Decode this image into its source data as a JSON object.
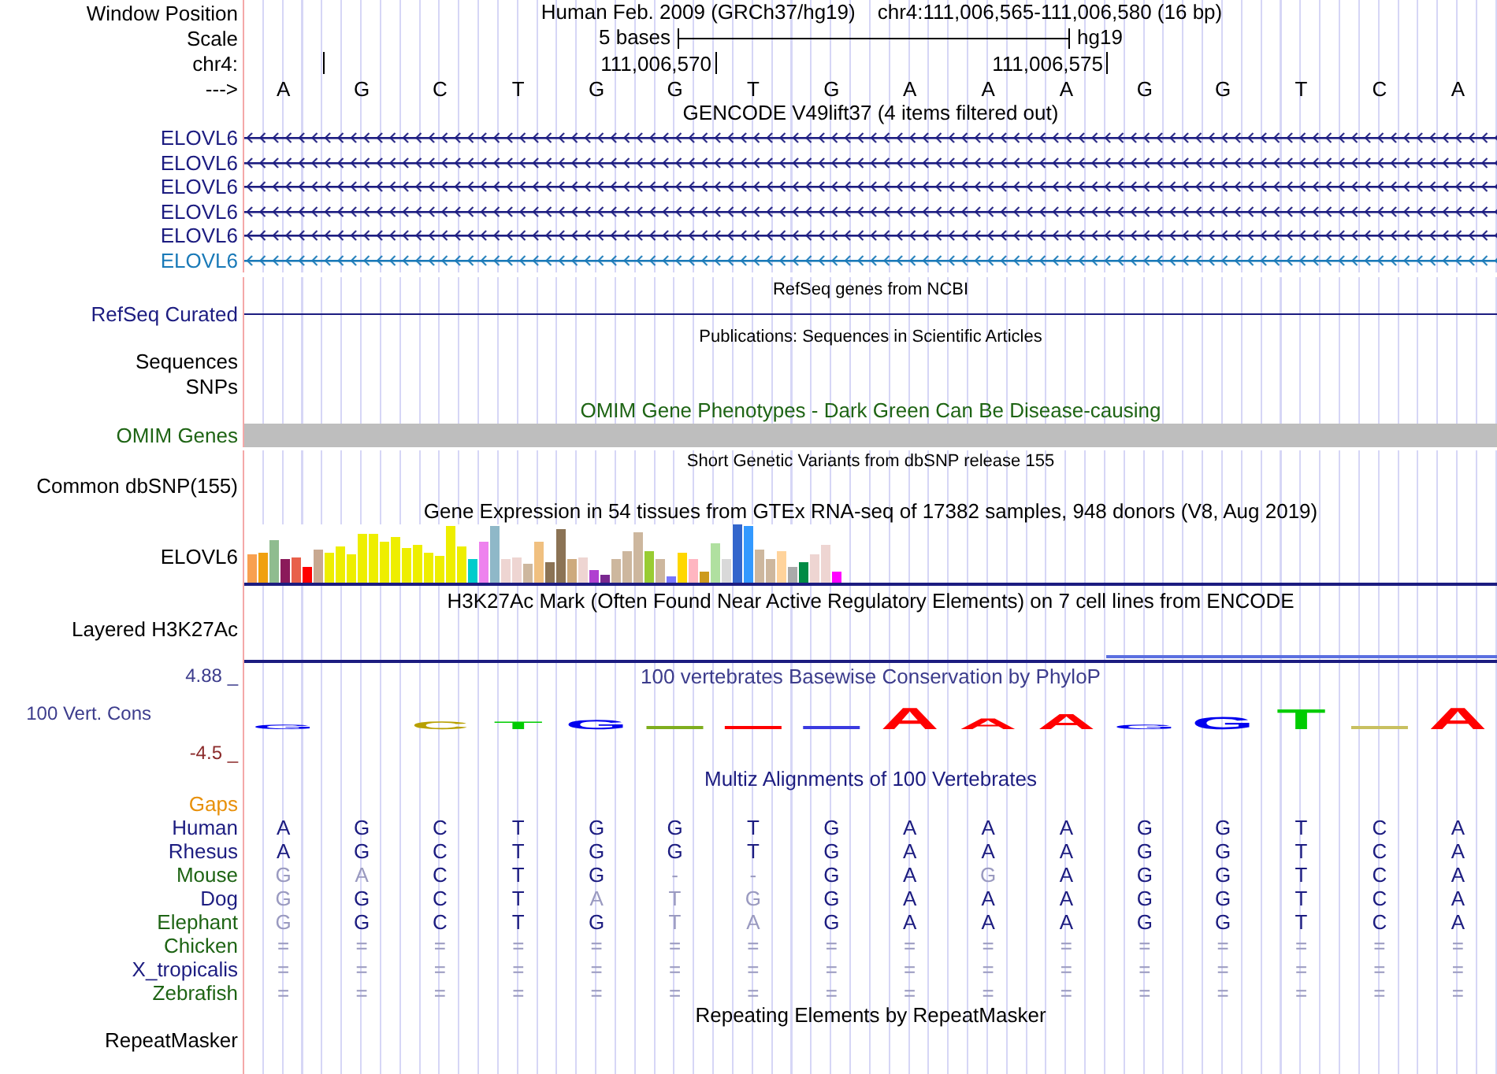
{
  "position_bar": {
    "label": "Window Position",
    "assembly": "Human Feb. 2009 (GRCh37/hg19)",
    "range": "chr4:111,006,565-111,006,580 (16 bp)"
  },
  "scale": {
    "label": "Scale",
    "span": "5 bases",
    "assembly": "hg19"
  },
  "ruler": {
    "label": "chr4:",
    "ticks": [
      "111,006,570",
      "111,006,575"
    ]
  },
  "sequence": {
    "label": "--->",
    "bases": [
      "A",
      "G",
      "C",
      "T",
      "G",
      "G",
      "T",
      "G",
      "A",
      "A",
      "A",
      "G",
      "G",
      "T",
      "C",
      "A"
    ]
  },
  "tracks": [
    {
      "kind": "genes",
      "title": "GENCODE V49lift37 (4 items filtered out)",
      "items": [
        {
          "label": "ELOVL6",
          "color": "#1c1c80"
        },
        {
          "label": "ELOVL6",
          "color": "#1c1c80"
        },
        {
          "label": "ELOVL6",
          "color": "#1c1c80"
        },
        {
          "label": "ELOVL6",
          "color": "#1c1c80"
        },
        {
          "label": "ELOVL6",
          "color": "#1c1c80"
        },
        {
          "label": "ELOVL6",
          "color": "#1a7ab8"
        }
      ]
    },
    {
      "kind": "line",
      "title": "RefSeq genes from NCBI",
      "label": "RefSeq Curated",
      "color": "#1c1c80"
    },
    {
      "kind": "labels",
      "title": "Publications: Sequences in Scientific Articles",
      "labels": [
        "Sequences",
        "SNPs"
      ]
    },
    {
      "kind": "bar",
      "title": "OMIM Gene Phenotypes - Dark Green Can Be Disease-causing",
      "label": "OMIM Genes",
      "color": "#1e6414"
    },
    {
      "kind": "labels",
      "title": "Short Genetic Variants from dbSNP release 155",
      "labels": [
        "Common dbSNP(155)"
      ]
    },
    {
      "kind": "expression",
      "title": "Gene Expression in 54 tissues from GTEx RNA-seq of 17382 samples, 948 donors (V8, Aug 2019)",
      "label": "ELOVL6"
    },
    {
      "kind": "signal",
      "title": "H3K27Ac Mark (Often Found Near Active Regulatory Elements) on 7 cell lines from ENCODE",
      "label": "Layered H3K27Ac"
    },
    {
      "kind": "conservation",
      "title": "100 vertebrates Basewise Conservation by PhyloP",
      "label": "100 Vert. Cons",
      "max": "4.88 _",
      "min": "-4.5 _",
      "logo": [
        {
          "kind": "letter",
          "letter": "G"
        },
        {
          "kind": "blank"
        },
        {
          "kind": "letter",
          "letter": "C"
        },
        {
          "kind": "letter",
          "letter": "T"
        },
        {
          "kind": "letter",
          "letter": "G"
        },
        {
          "kind": "flat",
          "color": "#7fae1e"
        },
        {
          "kind": "flat",
          "color": "#ff0000"
        },
        {
          "kind": "flat",
          "color": "#3a3ae0"
        },
        {
          "kind": "letter",
          "letter": "A"
        },
        {
          "kind": "letter",
          "letter": "A"
        },
        {
          "kind": "letter",
          "letter": "A"
        },
        {
          "kind": "letter",
          "letter": "G"
        },
        {
          "kind": "letter",
          "letter": "G"
        },
        {
          "kind": "letter",
          "letter": "T"
        },
        {
          "kind": "flat",
          "color": "#c8c060"
        },
        {
          "kind": "letter",
          "letter": "A"
        }
      ]
    },
    {
      "kind": "alignment",
      "title": "Multiz Alignments of 100 Vertebrates",
      "gaps_label": "Gaps",
      "species": [
        {
          "name": "Human",
          "color": "#1c1c80",
          "bases": [
            {
              "b": "A",
              "faded": false
            },
            {
              "b": "G",
              "faded": false
            },
            {
              "b": "C",
              "faded": false
            },
            {
              "b": "T",
              "faded": false
            },
            {
              "b": "G",
              "faded": false
            },
            {
              "b": "G",
              "faded": false
            },
            {
              "b": "T",
              "faded": false
            },
            {
              "b": "G",
              "faded": false
            },
            {
              "b": "A",
              "faded": false
            },
            {
              "b": "A",
              "faded": false
            },
            {
              "b": "A",
              "faded": false
            },
            {
              "b": "G",
              "faded": false
            },
            {
              "b": "G",
              "faded": false
            },
            {
              "b": "T",
              "faded": false
            },
            {
              "b": "C",
              "faded": false
            },
            {
              "b": "A",
              "faded": false
            }
          ]
        },
        {
          "name": "Rhesus",
          "color": "#1c1c80",
          "bases": [
            {
              "b": "A",
              "faded": false
            },
            {
              "b": "G",
              "faded": false
            },
            {
              "b": "C",
              "faded": false
            },
            {
              "b": "T",
              "faded": false
            },
            {
              "b": "G",
              "faded": false
            },
            {
              "b": "G",
              "faded": false
            },
            {
              "b": "T",
              "faded": false
            },
            {
              "b": "G",
              "faded": false
            },
            {
              "b": "A",
              "faded": false
            },
            {
              "b": "A",
              "faded": false
            },
            {
              "b": "A",
              "faded": false
            },
            {
              "b": "G",
              "faded": false
            },
            {
              "b": "G",
              "faded": false
            },
            {
              "b": "T",
              "faded": false
            },
            {
              "b": "C",
              "faded": false
            },
            {
              "b": "A",
              "faded": false
            }
          ]
        },
        {
          "name": "Mouse",
          "color": "#1e6414",
          "bases": [
            {
              "b": "G",
              "faded": true
            },
            {
              "b": "A",
              "faded": true
            },
            {
              "b": "C",
              "faded": false
            },
            {
              "b": "T",
              "faded": false
            },
            {
              "b": "G",
              "faded": false
            },
            {
              "b": "-",
              "faded": true
            },
            {
              "b": "-",
              "faded": true
            },
            {
              "b": "G",
              "faded": false
            },
            {
              "b": "A",
              "faded": false
            },
            {
              "b": "G",
              "faded": true
            },
            {
              "b": "A",
              "faded": false
            },
            {
              "b": "G",
              "faded": false
            },
            {
              "b": "G",
              "faded": false
            },
            {
              "b": "T",
              "faded": false
            },
            {
              "b": "C",
              "faded": false
            },
            {
              "b": "A",
              "faded": false
            }
          ]
        },
        {
          "name": "Dog",
          "color": "#1c1c80",
          "bases": [
            {
              "b": "G",
              "faded": true
            },
            {
              "b": "G",
              "faded": false
            },
            {
              "b": "C",
              "faded": false
            },
            {
              "b": "T",
              "faded": false
            },
            {
              "b": "A",
              "faded": true
            },
            {
              "b": "T",
              "faded": true
            },
            {
              "b": "G",
              "faded": true
            },
            {
              "b": "G",
              "faded": false
            },
            {
              "b": "A",
              "faded": false
            },
            {
              "b": "A",
              "faded": false
            },
            {
              "b": "A",
              "faded": false
            },
            {
              "b": "G",
              "faded": false
            },
            {
              "b": "G",
              "faded": false
            },
            {
              "b": "T",
              "faded": false
            },
            {
              "b": "C",
              "faded": false
            },
            {
              "b": "A",
              "faded": false
            }
          ]
        },
        {
          "name": "Elephant",
          "color": "#1e6414",
          "bases": [
            {
              "b": "G",
              "faded": true
            },
            {
              "b": "G",
              "faded": false
            },
            {
              "b": "C",
              "faded": false
            },
            {
              "b": "T",
              "faded": false
            },
            {
              "b": "G",
              "faded": false
            },
            {
              "b": "T",
              "faded": true
            },
            {
              "b": "A",
              "faded": true
            },
            {
              "b": "G",
              "faded": false
            },
            {
              "b": "A",
              "faded": false
            },
            {
              "b": "A",
              "faded": false
            },
            {
              "b": "A",
              "faded": false
            },
            {
              "b": "G",
              "faded": false
            },
            {
              "b": "G",
              "faded": false
            },
            {
              "b": "T",
              "faded": false
            },
            {
              "b": "C",
              "faded": false
            },
            {
              "b": "A",
              "faded": false
            }
          ]
        },
        {
          "name": "Chicken",
          "color": "#1e6414",
          "bases": [
            {
              "b": "=",
              "faded": true
            },
            {
              "b": "=",
              "faded": true
            },
            {
              "b": "=",
              "faded": true
            },
            {
              "b": "=",
              "faded": true
            },
            {
              "b": "=",
              "faded": true
            },
            {
              "b": "=",
              "faded": true
            },
            {
              "b": "=",
              "faded": true
            },
            {
              "b": "=",
              "faded": true
            },
            {
              "b": "=",
              "faded": true
            },
            {
              "b": "=",
              "faded": true
            },
            {
              "b": "=",
              "faded": true
            },
            {
              "b": "=",
              "faded": true
            },
            {
              "b": "=",
              "faded": true
            },
            {
              "b": "=",
              "faded": true
            },
            {
              "b": "=",
              "faded": true
            },
            {
              "b": "=",
              "faded": true
            }
          ]
        },
        {
          "name": "X_tropicalis",
          "color": "#1c1c80",
          "bases": [
            {
              "b": "=",
              "faded": true
            },
            {
              "b": "=",
              "faded": true
            },
            {
              "b": "=",
              "faded": true
            },
            {
              "b": "=",
              "faded": true
            },
            {
              "b": "=",
              "faded": true
            },
            {
              "b": "=",
              "faded": true
            },
            {
              "b": "=",
              "faded": true
            },
            {
              "b": "=",
              "faded": true
            },
            {
              "b": "=",
              "faded": true
            },
            {
              "b": "=",
              "faded": true
            },
            {
              "b": "=",
              "faded": true
            },
            {
              "b": "=",
              "faded": true
            },
            {
              "b": "=",
              "faded": true
            },
            {
              "b": "=",
              "faded": true
            },
            {
              "b": "=",
              "faded": true
            },
            {
              "b": "=",
              "faded": true
            }
          ]
        },
        {
          "name": "Zebrafish",
          "color": "#1e6414",
          "bases": [
            {
              "b": "=",
              "faded": true
            },
            {
              "b": "=",
              "faded": true
            },
            {
              "b": "=",
              "faded": true
            },
            {
              "b": "=",
              "faded": true
            },
            {
              "b": "=",
              "faded": true
            },
            {
              "b": "=",
              "faded": true
            },
            {
              "b": "=",
              "faded": true
            },
            {
              "b": "=",
              "faded": true
            },
            {
              "b": "=",
              "faded": true
            },
            {
              "b": "=",
              "faded": true
            },
            {
              "b": "=",
              "faded": true
            },
            {
              "b": "=",
              "faded": true
            },
            {
              "b": "=",
              "faded": true
            },
            {
              "b": "=",
              "faded": true
            },
            {
              "b": "=",
              "faded": true
            },
            {
              "b": "=",
              "faded": true
            }
          ]
        }
      ]
    },
    {
      "kind": "repeats",
      "title": "Repeating Elements by RepeatMasker",
      "label": "RepeatMasker"
    }
  ]
}
